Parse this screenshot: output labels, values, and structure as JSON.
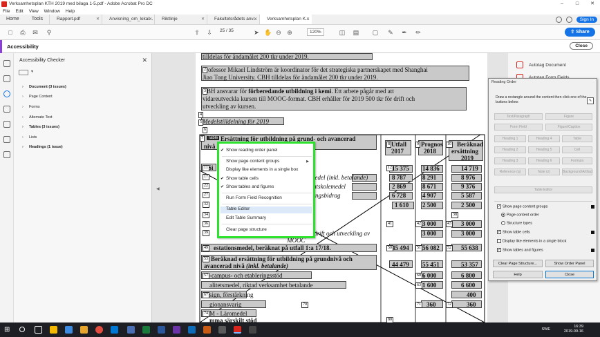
{
  "window": {
    "title": "Verksamhetsplan KTH 2019 med bilaga 1-5.pdf - Adobe Acrobat Pro DC",
    "menu": [
      "File",
      "Edit",
      "View",
      "Window",
      "Help"
    ]
  },
  "tabs": {
    "home": "Home",
    "tools": "Tools",
    "docs": [
      "Rapport.pdf",
      "Anvisning_om_lokal...",
      "Riktlinje",
      "Fakultetsrådets anv...",
      "Verksamhetsplan K..."
    ],
    "signin": "Sign In"
  },
  "toolbar": {
    "page_current": "25",
    "page_total": "/ 35",
    "zoom": "120%",
    "share_label": "Share"
  },
  "accessibility_bar": {
    "label": "Accessibility",
    "close_label": "Close"
  },
  "checker": {
    "title": "Accessibility Checker",
    "items": [
      {
        "label": "Document (3 issues)",
        "bold": true
      },
      {
        "label": "Page Content",
        "bold": false
      },
      {
        "label": "Forms",
        "bold": false
      },
      {
        "label": "Alternate Text",
        "bold": false
      },
      {
        "label": "Tables (3 issues)",
        "bold": true
      },
      {
        "label": "Lists",
        "bold": false
      },
      {
        "label": "Headings (1 issue)",
        "bold": true
      }
    ]
  },
  "document": {
    "line_top": "tilldelas för ändamålet 200 tkr under 2019.",
    "para2_l1": "Professor Mikael Lindström är koordinator för det strategiska partnerskapet med Shanghai",
    "para2_l2": "Jiao Tong University. CBH tilldelas för ändamålet 200 tkr under 2019.",
    "para3_l1a": "CBH ansvarar för ",
    "para3_l1b": "förberedande utbildning i kemi",
    "para3_l1c": ". Ett arbete pågår med att",
    "para3_l2": "vidareutveckla kursen till MOOC-format. CBH erhåller för 2019 500 tkr för drift och",
    "para3_l3": "utveckling av kursen.",
    "heading_medel": "Medelstilldelning för 2019",
    "table_head_a": "Ersättning för utbildning på grund- och avancerad",
    "table_head_b": "nivå",
    "col_utfall": "Utfall",
    "col_utfall_y": "2017",
    "col_prognos": "Prognos",
    "col_prognos_y": "2018",
    "col_beraknad": "Beräknad",
    "col_beraknad_y": "ersättning",
    "col_beraknad_y2": "2019",
    "rows": [
      {
        "label": "Si",
        "v1": "15 375",
        "v2": "14 836",
        "v3": "14 719"
      },
      {
        "label": "",
        "v1": "8 787",
        "v2": "8 291",
        "v3": "8 976"
      },
      {
        "label": "",
        "v1": "2 869",
        "v2": "8 671",
        "v3": "9 376"
      },
      {
        "label": "",
        "v1": "6 728",
        "v2": "4 907",
        "v3": "5 587"
      },
      {
        "label": "",
        "v1": "1 610",
        "v2": "2 500",
        "v3": "2 500"
      },
      {
        "label": "",
        "v1": "",
        "v2": "",
        "v3": ""
      },
      {
        "label": "",
        "v1": "",
        "v2": "3 000",
        "v3": "3 000"
      },
      {
        "label": "",
        "v1": "",
        "v2": "3 000",
        "v3": "3 000"
      }
    ],
    "row_italic_a": "medel (inkl. betalande)",
    "row_italic_b": "entskolemedel",
    "row_italic_c": "ningsbidrag",
    "row_drift": "- drift och utveckling av",
    "row_mooc": "MOOC",
    "row_summa_label": "estationsmedel, beräknat på utfall 1:a 17/18.",
    "row_summa_v1": "45 494",
    "row_summa_v2": "56 082",
    "row_summa_v3": "55 638",
    "row_ber_l1": "Beräknad ersättning för utbildning på grundnivå och",
    "row_ber_l2": "avancerad nivå ",
    "row_ber_l2_it": "(inkl. betalande)",
    "row_ber_v1": "44 479",
    "row_ber_v2": "55 451",
    "row_ber_v3": "53 357",
    "lower_rows": [
      {
        "label": "-campus- och etableringsstöd",
        "v1": "",
        "v2": "6 000",
        "v3": "6 800"
      },
      {
        "label": "alitetsmedel, riktad verksamhet betalande",
        "v1": "",
        "v2": "1 600",
        "v3": "6 600"
      },
      {
        "label": "sign, förstärkning",
        "v1": "",
        "v2": "",
        "v3": "400"
      },
      {
        "label": "gionansvarig",
        "v1": "",
        "v2": "360",
        "v3": "360"
      },
      {
        "label": "M - Läromedel",
        "v1": "",
        "v2": "",
        "v3": ""
      },
      {
        "label": "mma särskilt stöd",
        "v1": "",
        "v2": "",
        "v3": ""
      }
    ],
    "lower_tag_70": "70",
    "table_tag": "Table",
    "tags": [
      "1",
      "2",
      "3",
      "4",
      "5",
      "6",
      "7",
      "8",
      "9",
      "10",
      "11",
      "17",
      "22",
      "27",
      "32",
      "34",
      "36",
      "38",
      "39",
      "41",
      "42",
      "43",
      "44",
      "45",
      "46",
      "47",
      "48",
      "49",
      "50",
      "51",
      "52",
      "53",
      "57",
      "62",
      "63",
      "67",
      "71",
      "72",
      "74",
      "75",
      "76",
      "80"
    ]
  },
  "context_menu": {
    "items": [
      {
        "label": "Show reading order panel",
        "checked": true,
        "submenu": false
      },
      {
        "label": "Show page content groups",
        "checked": false,
        "submenu": true
      },
      {
        "label": "Display like elements in a single box",
        "checked": false,
        "submenu": false
      },
      {
        "label": "Show table cells",
        "checked": true,
        "submenu": false
      },
      {
        "label": "Show tables and figures",
        "checked": true,
        "submenu": false
      },
      {
        "label": "Run Form Field Recognition",
        "checked": false,
        "submenu": false
      },
      {
        "label": "Table Editor",
        "checked": false,
        "submenu": false
      },
      {
        "label": "Edit Table Summary",
        "checked": false,
        "submenu": false
      },
      {
        "label": "Clear page structure",
        "checked": false,
        "submenu": false
      }
    ]
  },
  "right_tools": {
    "items": [
      "Autotag Document",
      "Autotag Form Fields"
    ]
  },
  "reading_order": {
    "title": "Reading Order",
    "description": "Draw a rectangle around the content then click one of the buttons below:",
    "buttons": [
      "Text/Paragraph",
      "Figure",
      "Form Field",
      "Figure/Caption",
      "Heading 1",
      "Heading 4",
      "Table",
      "Heading 2",
      "Heading 5",
      "Cell",
      "Heading 3",
      "Heading 6",
      "Formula",
      "Reference (q)",
      "Note (z)",
      "Background/Artifact"
    ],
    "table_editor": "Table Editor",
    "show_groups": "Show page content groups",
    "page_content_order": "Page content order",
    "structure_types": "Structure types",
    "show_table_cells": "Show table cells",
    "display_like": "Display like elements in a single block",
    "show_tables_figures": "Show tables and figures",
    "clear_btn": "Clear Page Structure...",
    "show_order_btn": "Show Order Panel",
    "help_btn": "Help",
    "close_btn": "Close"
  },
  "taskbar": {
    "lang": "SWE",
    "time": "16:39",
    "date": "2019-09-16"
  },
  "colors": {
    "accent_blue": "#1473e6",
    "accent_purple": "#8c3fd6",
    "highlight_green": "#2de22d",
    "acrobat_red": "#d8251d"
  }
}
